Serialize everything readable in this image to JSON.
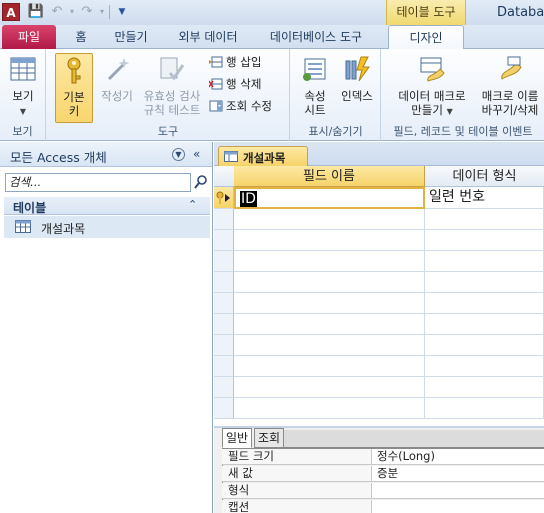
{
  "app": {
    "icon_letter": "A",
    "window_title": "Database",
    "context_group": "테이블 도구"
  },
  "tabs": {
    "file": "파일",
    "items": [
      "홈",
      "만들기",
      "외부 데이터",
      "데이터베이스 도구"
    ],
    "design": "디자인"
  },
  "ribbon": {
    "view": {
      "label": "보기",
      "group": "보기"
    },
    "tools": {
      "group": "도구",
      "primary_key": "기본\n키",
      "builder": "작성기",
      "test_validation": "유효성 검사\n규칙 테스트",
      "insert_row": "행 삽입",
      "delete_row": "행 삭제",
      "modify_lookups": "조회 수정"
    },
    "show_hide": {
      "group": "표시/숨기기",
      "property_sheet": "속성\n시트",
      "indexes": "인덱스"
    },
    "field_events": {
      "group": "필드, 레코드 및 테이블 이벤트",
      "create_macros": "데이터 매크로\n만들기",
      "rename_macro": "매크로 이름\n바꾸기/삭제"
    }
  },
  "nav": {
    "title": "모든 Access 개체",
    "search_placeholder": "검색...",
    "group_label": "테이블",
    "items": [
      "개설과목"
    ]
  },
  "document": {
    "tab_label": "개설과목",
    "columns": [
      "필드 이름",
      "데이터 형식"
    ],
    "rows": [
      {
        "field": "ID",
        "type": "일련 번호"
      }
    ]
  },
  "properties": {
    "tabs": [
      "일반",
      "조회"
    ],
    "rows": [
      {
        "label": "필드 크기",
        "value": "정수(Long)"
      },
      {
        "label": "새 값",
        "value": "증분"
      },
      {
        "label": "형식",
        "value": ""
      },
      {
        "label": "캡션",
        "value": ""
      }
    ]
  },
  "colors": {
    "file_tab": "#c42b52",
    "context_tab": "#f2dc7a",
    "selection": "#f8d56e",
    "brand_red": "#a4262c"
  }
}
